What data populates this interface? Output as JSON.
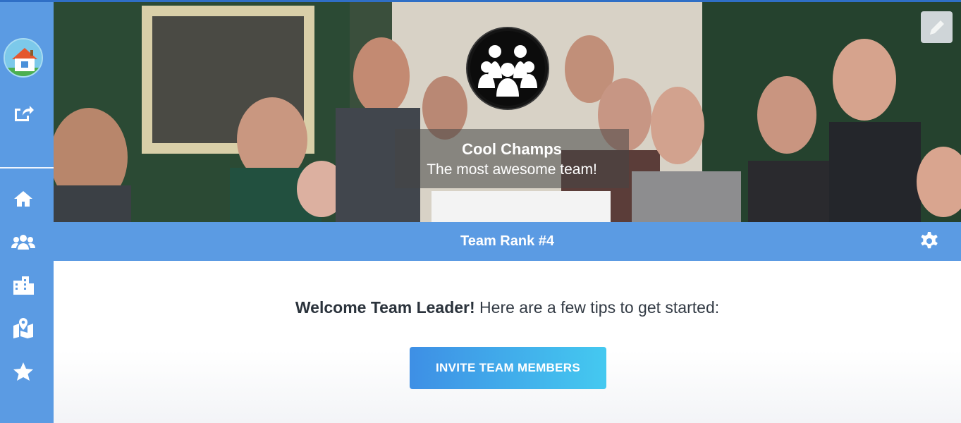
{
  "sidebar": {
    "icons": [
      "home-house-logo",
      "share-out-icon",
      "home-icon",
      "team-users-icon",
      "buildings-icon",
      "map-marker-icon",
      "star-icon"
    ]
  },
  "banner": {
    "team_name": "Cool Champs",
    "team_motto": "The most awesome team!",
    "edit_icon": "pencil-icon"
  },
  "rank_bar": {
    "label": "Team Rank #4",
    "settings_icon": "gear-icon"
  },
  "main": {
    "welcome_bold": "Welcome Team Leader!",
    "welcome_rest": " Here are a few tips to get started:",
    "invite_button": "INVITE TEAM MEMBERS"
  },
  "colors": {
    "sidebar": "#5b9be3",
    "rank_bar": "#5b9be3",
    "button_gradient_start": "#3e8fe5",
    "button_gradient_end": "#44c9f0"
  }
}
